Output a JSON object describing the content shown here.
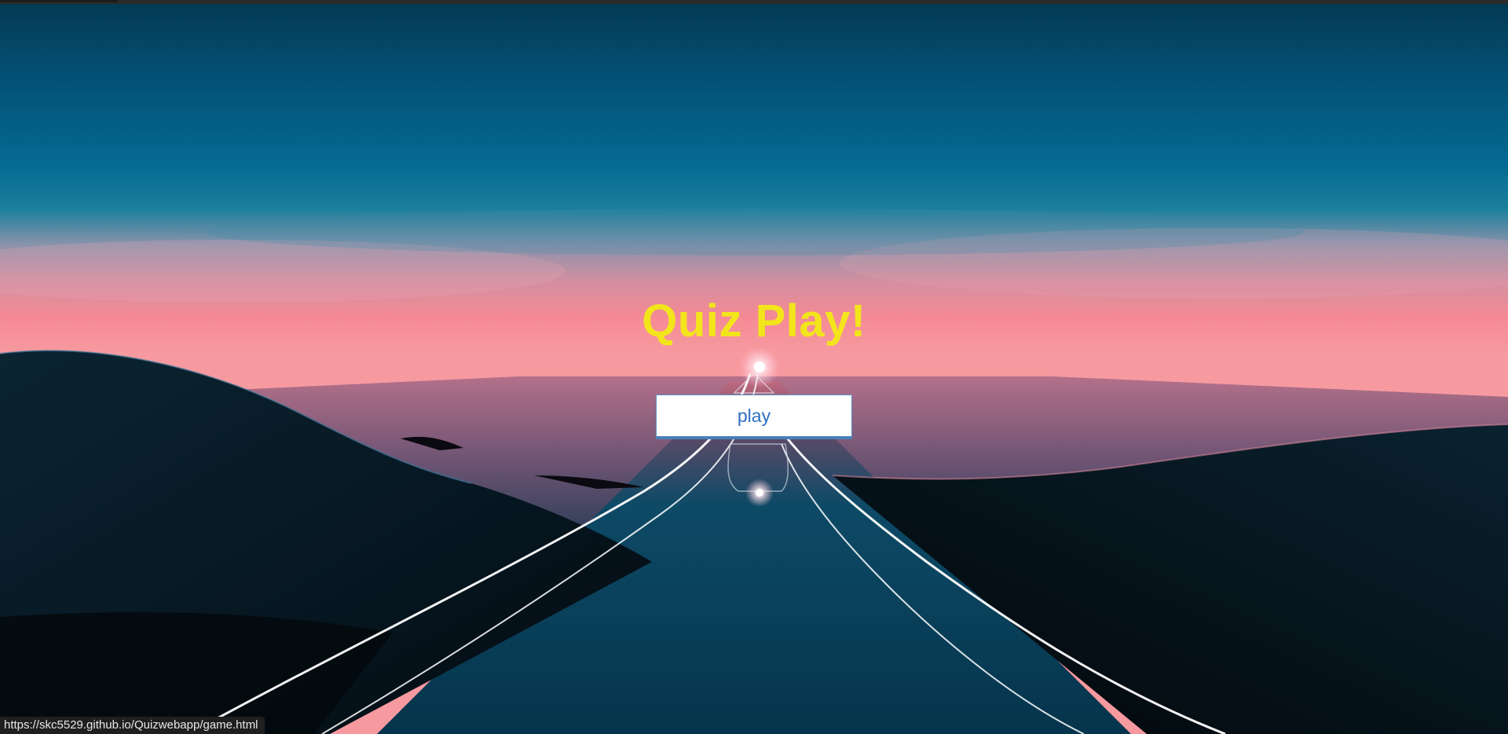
{
  "hero": {
    "title": "Quiz Play!",
    "play_label": "play"
  },
  "status_bar": {
    "url": "https://skc5529.github.io/Quizwebapp/game.html"
  },
  "colors": {
    "title": "#f2e51c",
    "button_text": "#2f6fc4",
    "button_bg": "#ffffff",
    "sky_top": "#034a6a",
    "horizon_pink": "#f58a94"
  },
  "background": {
    "scene": "synthwave-road-landscape"
  }
}
